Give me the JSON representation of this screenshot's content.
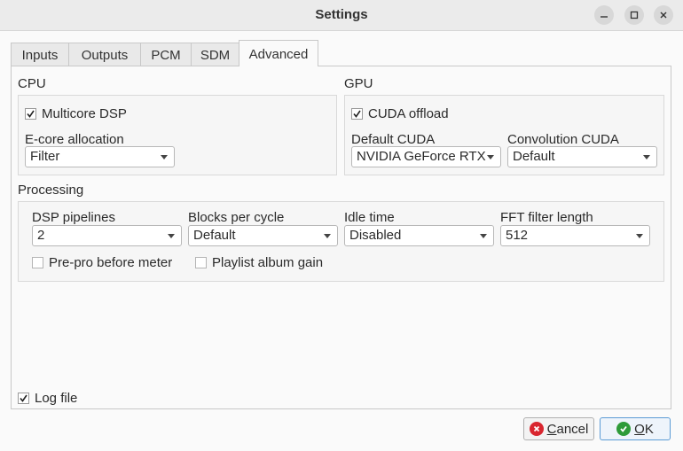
{
  "window": {
    "title": "Settings",
    "controls": {
      "minimize_icon": "minimize-icon",
      "maximize_icon": "maximize-icon",
      "close_icon": "close-icon"
    }
  },
  "tabs": [
    {
      "label": "Inputs"
    },
    {
      "label": "Outputs"
    },
    {
      "label": "PCM"
    },
    {
      "label": "SDM"
    },
    {
      "label": "Advanced",
      "active": true
    }
  ],
  "cpu": {
    "title": "CPU",
    "multicore": {
      "label": "Multicore DSP",
      "checked": true
    },
    "ecore_label": "E-core allocation",
    "ecore_value": "Filter"
  },
  "gpu": {
    "title": "GPU",
    "cuda_offload": {
      "label": "CUDA offload",
      "checked": true
    },
    "default_cuda_label": "Default CUDA",
    "default_cuda_value": "NVIDIA GeForce RTX",
    "convolution_cuda_label": "Convolution CUDA",
    "convolution_cuda_value": "Default"
  },
  "processing": {
    "title": "Processing",
    "dsp_pipelines_label": "DSP pipelines",
    "dsp_pipelines_value": "2",
    "blocks_label": "Blocks per cycle",
    "blocks_value": "Default",
    "idle_label": "Idle time",
    "idle_value": "Disabled",
    "fft_label": "FFT filter length",
    "fft_value": "512",
    "prepro": {
      "label": "Pre-pro before meter",
      "checked": false
    },
    "playlist_gain": {
      "label": "Playlist album gain",
      "checked": false
    }
  },
  "log_file": {
    "label": "Log file",
    "checked": true
  },
  "buttons": {
    "cancel_first": "C",
    "cancel_rest": "ancel",
    "ok_first": "O",
    "ok_rest": "K"
  },
  "colors": {
    "cancel_icon": "#d9262f",
    "ok_icon": "#2e9b3a",
    "accent": "#5b9bd5"
  }
}
